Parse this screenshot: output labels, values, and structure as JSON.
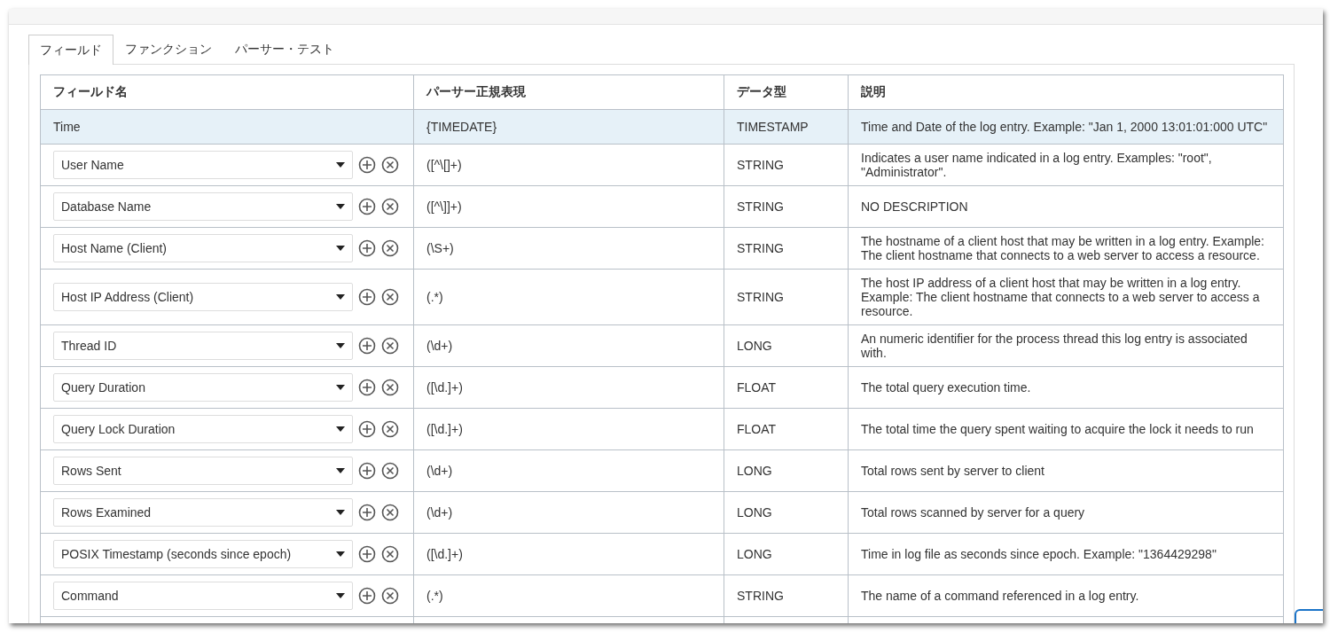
{
  "tabs": [
    {
      "label": "フィールド",
      "selected": true
    },
    {
      "label": "ファンクション",
      "selected": false
    },
    {
      "label": "パーサー・テスト",
      "selected": false
    }
  ],
  "table": {
    "columns": [
      "フィールド名",
      "パーサー正規表現",
      "データ型",
      "説明"
    ],
    "rows": [
      {
        "kind": "static",
        "selected": true,
        "field": "Time",
        "regex": "{TIMEDATE}",
        "type": "TIMESTAMP",
        "description": "Time and Date of the log entry. Example: \"Jan 1, 2000 13:01:01:000 UTC\""
      },
      {
        "kind": "select",
        "selected": false,
        "field": "User Name",
        "regex": "([^\\[]+)",
        "type": "STRING",
        "description": "Indicates a user name indicated in a log entry. Examples: \"root\", \"Administrator\"."
      },
      {
        "kind": "select",
        "selected": false,
        "field": "Database Name",
        "regex": "([^\\]]+)",
        "type": "STRING",
        "description": "NO DESCRIPTION"
      },
      {
        "kind": "select",
        "selected": false,
        "field": "Host Name (Client)",
        "regex": "(\\S+)",
        "type": "STRING",
        "description": "The hostname of a client host that may be written in a log entry. Example: The client hostname that connects to a web server to access a resource."
      },
      {
        "kind": "select",
        "selected": false,
        "field": "Host IP Address (Client)",
        "regex": "(.*)",
        "type": "STRING",
        "description": "The host IP address of a client host that may be written in a log entry. Example: The client hostname that connects to a web server to access a resource."
      },
      {
        "kind": "select",
        "selected": false,
        "field": "Thread ID",
        "regex": "(\\d+)",
        "type": "LONG",
        "description": "An numeric identifier for the process thread this log entry is associated with."
      },
      {
        "kind": "select",
        "selected": false,
        "field": "Query Duration",
        "regex": "([\\d.]+)",
        "type": "FLOAT",
        "description": "The total query execution time."
      },
      {
        "kind": "select",
        "selected": false,
        "field": "Query Lock Duration",
        "regex": "([\\d.]+)",
        "type": "FLOAT",
        "description": "The total time the query spent waiting to acquire the lock it needs to run"
      },
      {
        "kind": "select",
        "selected": false,
        "field": "Rows Sent",
        "regex": "(\\d+)",
        "type": "LONG",
        "description": "Total rows sent by server to client"
      },
      {
        "kind": "select",
        "selected": false,
        "field": "Rows Examined",
        "regex": "(\\d+)",
        "type": "LONG",
        "description": "Total rows scanned by server for a query"
      },
      {
        "kind": "select",
        "selected": false,
        "field": "POSIX Timestamp (seconds since epoch)",
        "regex": "([\\d.]+)",
        "type": "LONG",
        "description": "Time in log file as seconds since epoch. Example: \"1364429298\""
      },
      {
        "kind": "select",
        "selected": false,
        "field": "Command",
        "regex": "(.*)",
        "type": "STRING",
        "description": "The name of a command referenced in a log entry."
      }
    ]
  }
}
